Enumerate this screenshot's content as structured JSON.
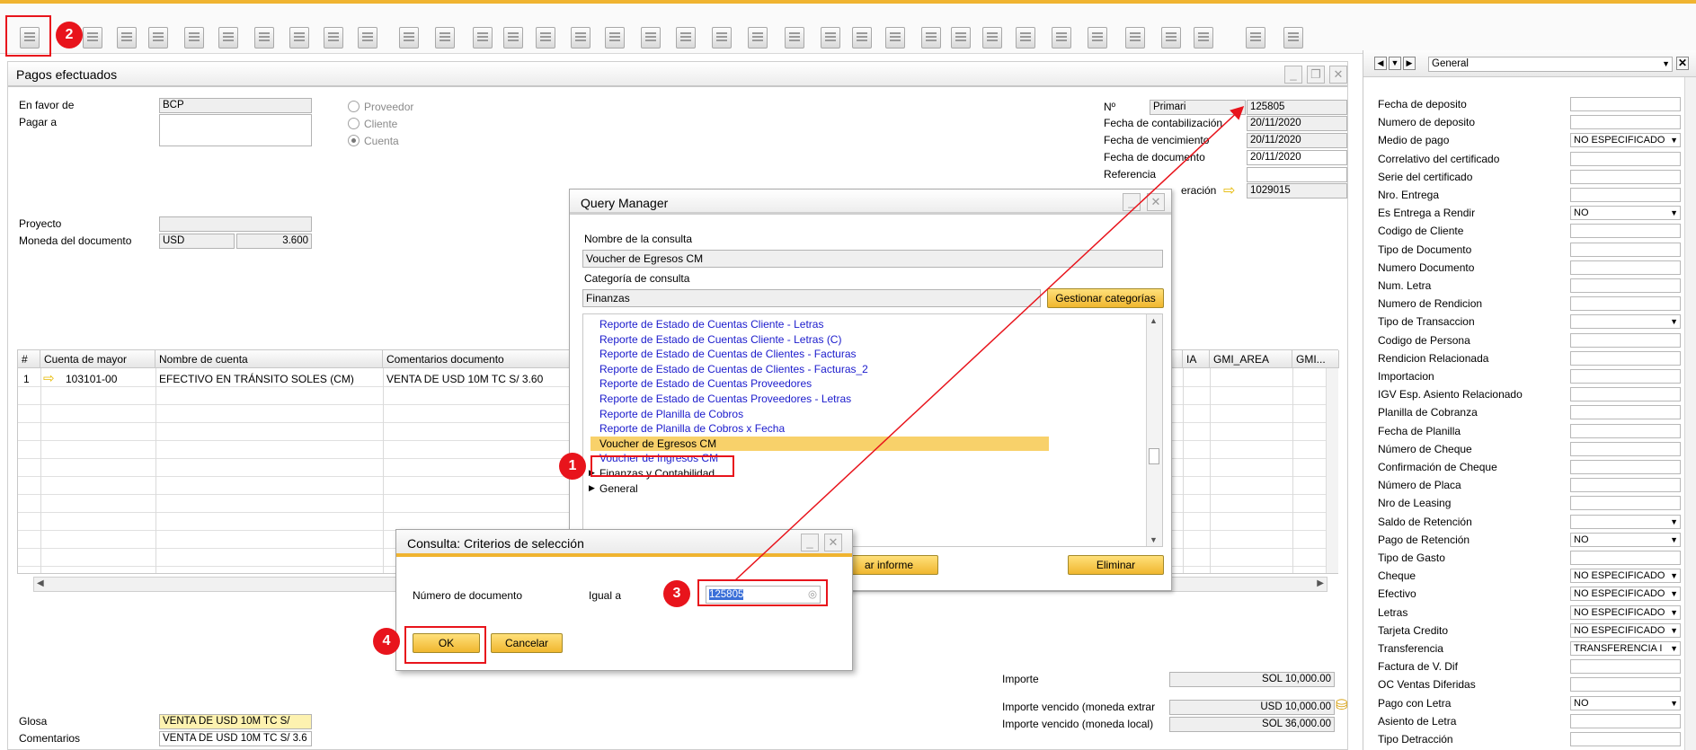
{
  "toolbar": {
    "icons": [
      "preview-icon",
      "print-icon",
      "email-icon",
      "sms-icon",
      "fax-icon",
      "export-excel-icon",
      "export-word-icon",
      "export-pdf-icon",
      "launch-app-icon",
      "lock-icon",
      "find-icon",
      "add-icon",
      "first-record-icon",
      "previous-record-icon",
      "next-record-icon",
      "last-record-icon",
      "refresh-icon",
      "filter-icon",
      "sort-icon",
      "base-document-icon",
      "target-document-icon",
      "document-flow-icon",
      "gross-profit-icon",
      "journal-icon",
      "payment-means-icon",
      "settings-icon",
      "edit-icon",
      "form-settings-icon",
      "user-fields-icon",
      "calendar-icon",
      "messages-icon",
      "spreadsheet-icon",
      "org-chart-icon",
      "help-icon",
      "query-manager-icon",
      "reports-icon"
    ]
  },
  "main": {
    "title": "Pagos efectuados",
    "en_favor_de_label": "En favor de",
    "en_favor_de_value": "BCP",
    "pagar_a_label": "Pagar a",
    "proveedor_label": "Proveedor",
    "cliente_label": "Cliente",
    "cuenta_label": "Cuenta",
    "proyecto_label": "Proyecto",
    "moneda_label": "Moneda del documento",
    "moneda_value": "USD",
    "tipo_cambio": "3.600",
    "no_label": "Nº",
    "serie_value": "Primari",
    "numero_value": "125805",
    "fecha_cont_label": "Fecha de contabilización",
    "fecha_cont_value": "20/11/2020",
    "fecha_venc_label": "Fecha de vencimiento",
    "fecha_venc_value": "20/11/2020",
    "fecha_doc_label": "Fecha de documento",
    "fecha_doc_value": "20/11/2020",
    "referencia_label": "Referencia",
    "transaccion_label": "eración",
    "transaccion_value": "1029015",
    "importe_label": "Importe",
    "importe_value": "SOL 10,000.00",
    "importe_venc_ext_label": "Importe vencido (moneda extrar",
    "importe_venc_ext_value": "USD 10,000.00",
    "importe_venc_local_label": "Importe vencido (moneda local)",
    "importe_venc_local_value": "SOL 36,000.00",
    "glosa_label": "Glosa",
    "glosa_value": "VENTA DE USD 10M TC S/",
    "comentarios_label": "Comentarios",
    "comentarios_value": "VENTA DE USD 10M TC S/ 3.6"
  },
  "grid": {
    "headers": [
      "#",
      "Cuenta de mayor",
      "Nombre de cuenta",
      "Comentarios documento",
      "IA",
      "GMI_AREA",
      "GMI..."
    ],
    "rows": [
      {
        "n": "1",
        "cuenta": "103101-00",
        "nombre": "EFECTIVO EN TRÁNSITO SOLES (CM)",
        "comentario": "VENTA DE USD 10M TC S/ 3.60"
      }
    ]
  },
  "right_panel": {
    "category": "General",
    "fields": [
      {
        "label": "Fecha de deposito",
        "value": ""
      },
      {
        "label": "Numero de deposito",
        "value": ""
      },
      {
        "label": "Medio de pago",
        "value": "NO ESPECIFICADO",
        "dropdown": true
      },
      {
        "label": "Correlativo del certificado",
        "value": ""
      },
      {
        "label": "Serie del certificado",
        "value": ""
      },
      {
        "label": "Nro. Entrega",
        "value": ""
      },
      {
        "label": "Es Entrega a Rendir",
        "value": "NO",
        "dropdown": true
      },
      {
        "label": "Codigo de Cliente",
        "value": ""
      },
      {
        "label": "Tipo de Documento",
        "value": ""
      },
      {
        "label": "Numero Documento",
        "value": ""
      },
      {
        "label": "Num. Letra",
        "value": ""
      },
      {
        "label": "Numero de Rendicion",
        "value": ""
      },
      {
        "label": "Tipo de Transaccion",
        "value": "",
        "dropdown": true
      },
      {
        "label": "Codigo de Persona",
        "value": ""
      },
      {
        "label": "Rendicion Relacionada",
        "value": ""
      },
      {
        "label": "Importacion",
        "value": ""
      },
      {
        "label": "IGV Esp. Asiento Relacionado",
        "value": ""
      },
      {
        "label": "Planilla de Cobranza",
        "value": ""
      },
      {
        "label": "Fecha de Planilla",
        "value": ""
      },
      {
        "label": "Número de Cheque",
        "value": ""
      },
      {
        "label": "Confirmación de Cheque",
        "value": ""
      },
      {
        "label": "Número de Placa",
        "value": ""
      },
      {
        "label": "Nro de Leasing",
        "value": ""
      },
      {
        "label": "Saldo de Retención",
        "value": "",
        "dropdown": true
      },
      {
        "label": "Pago de Retención",
        "value": "NO",
        "dropdown": true
      },
      {
        "label": "Tipo de Gasto",
        "value": ""
      },
      {
        "label": "Cheque",
        "value": "NO ESPECIFICADO",
        "dropdown": true
      },
      {
        "label": "Efectivo",
        "value": "NO ESPECIFICADO",
        "dropdown": true
      },
      {
        "label": "Letras",
        "value": "NO ESPECIFICADO",
        "dropdown": true
      },
      {
        "label": "Tarjeta Credito",
        "value": "NO ESPECIFICADO",
        "dropdown": true
      },
      {
        "label": "Transferencia",
        "value": "TRANSFERENCIA I",
        "dropdown": true
      },
      {
        "label": "Factura de V. Dif",
        "value": ""
      },
      {
        "label": "OC Ventas Diferidas",
        "value": ""
      },
      {
        "label": "Pago con Letra",
        "value": "NO",
        "dropdown": true
      },
      {
        "label": "Asiento de Letra",
        "value": ""
      },
      {
        "label": "Tipo Detracción",
        "value": ""
      }
    ]
  },
  "query_manager": {
    "title": "Query Manager",
    "nombre_label": "Nombre de la consulta",
    "nombre_value": "Voucher de Egresos CM",
    "categoria_label": "Categoría de consulta",
    "categoria_value": "Finanzas",
    "gestionar_btn": "Gestionar categorías",
    "queries": [
      "Reporte de Estado de Cuentas Cliente - Letras",
      "Reporte de Estado de Cuentas Cliente - Letras (C)",
      "Reporte de Estado de Cuentas de Clientes - Facturas",
      "Reporte de Estado de Cuentas de Clientes - Facturas_2",
      "Reporte de Estado de Cuentas Proveedores",
      "Reporte de Estado de Cuentas Proveedores - Letras",
      "Reporte de Planilla de Cobros",
      "Reporte de Planilla de Cobros x Fecha",
      "Voucher de Egresos CM",
      "Voucher de Ingresos CM"
    ],
    "selected_index": 8,
    "groups": [
      "Finanzas y Contabilidad",
      "General"
    ],
    "ejecutar_btn": "ar informe",
    "eliminar_btn": "Eliminar"
  },
  "criteria_dialog": {
    "title": "Consulta: Criterios de selección",
    "field_label": "Número de documento",
    "operator": "Igual a",
    "value": "125805",
    "ok_btn": "OK",
    "cancel_btn": "Cancelar"
  },
  "annotations": {
    "step1": "1",
    "step2": "2",
    "step3": "3",
    "step4": "4",
    "color": "#e8141c"
  }
}
